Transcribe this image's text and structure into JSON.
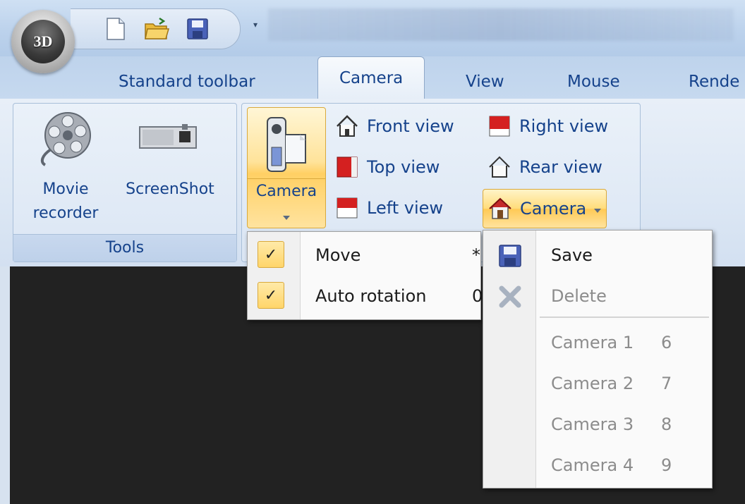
{
  "app": {
    "logo_text": "3D"
  },
  "quick_access": {
    "items": [
      {
        "icon": "new-document-icon"
      },
      {
        "icon": "open-folder-icon"
      },
      {
        "icon": "save-icon"
      }
    ],
    "customize_glyph": "▾"
  },
  "tabs": [
    "Standard toolbar",
    "Camera",
    "View",
    "Mouse",
    "Rende"
  ],
  "tools_group": {
    "label": "Tools",
    "movie_recorder": "Movie recorder",
    "screenshot": "ScreenShot"
  },
  "camera_group": {
    "camera_button": "Camera",
    "views": {
      "front": "Front view",
      "right": "Right view",
      "top": "Top view",
      "rear": "Rear view",
      "left": "Left view",
      "camera_dropdown": "Camera"
    }
  },
  "camera_menu": {
    "items": [
      {
        "label": "Move",
        "key": "*",
        "checked": true
      },
      {
        "label": "Auto rotation",
        "key": "0",
        "checked": true
      }
    ]
  },
  "camera_presets_menu": {
    "save": "Save",
    "delete": "Delete",
    "presets": [
      {
        "label": "Camera 1",
        "key": "6"
      },
      {
        "label": "Camera 2",
        "key": "7"
      },
      {
        "label": "Camera 3",
        "key": "8"
      },
      {
        "label": "Camera 4",
        "key": "9"
      }
    ]
  },
  "colors": {
    "ribbon_text": "#15428b",
    "highlight": "#ffd56a",
    "disabled_text": "#8c8c8c"
  }
}
